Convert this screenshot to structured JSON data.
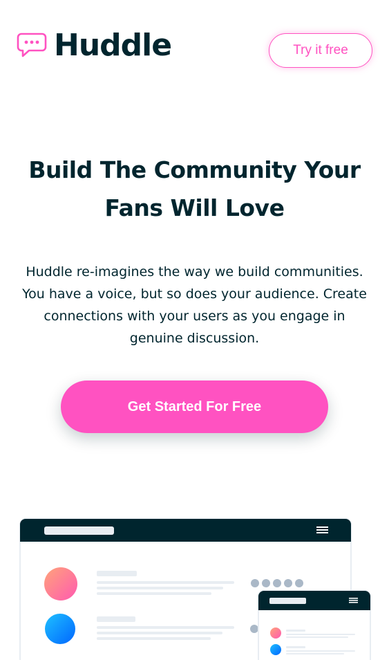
{
  "header": {
    "brand_name": "Huddle",
    "try_label": "Try it free"
  },
  "hero": {
    "title": "Build The Community Your Fans Will Love",
    "text": "Huddle re-imagines the way we build communities. You have a voice, but so does your audience. Create connections with your users as you engage in genuine discussion.",
    "cta_label": "Get Started For Free"
  },
  "colors": {
    "accent": "#ff52c1",
    "dark": "#00252e",
    "text": "#00252e"
  },
  "icons": {
    "brand": "chat-bubble-icon",
    "menu": "hamburger-menu-icon"
  }
}
